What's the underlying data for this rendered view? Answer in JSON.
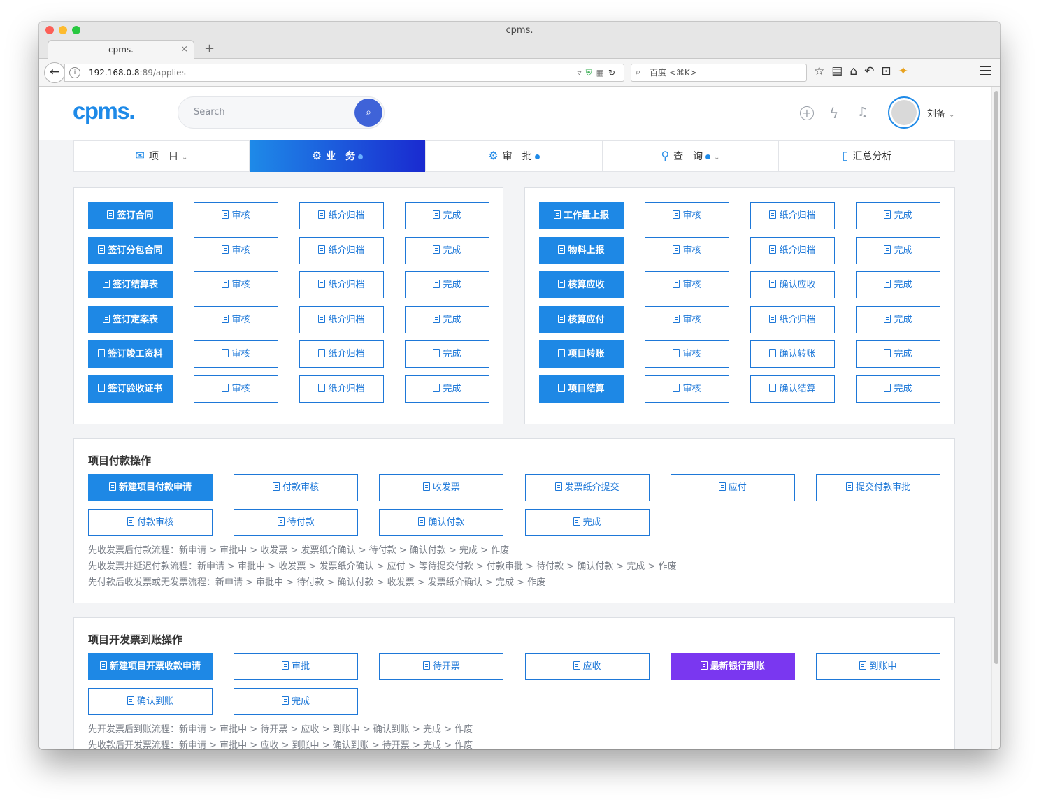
{
  "browser": {
    "window_title": "cpms.",
    "tab_title": "cpms.",
    "tab_close": "×",
    "new_tab": "+",
    "url_host": "192.168.0.8",
    "url_path": ":89/applies",
    "search_placeholder": "百度 <⌘K>"
  },
  "header": {
    "logo": "cpms.",
    "search_placeholder": "Search",
    "user_name": "刘备"
  },
  "nav": [
    {
      "label": "项　目",
      "icon": "envelope-icon",
      "dot": false,
      "chevron": true
    },
    {
      "label": "业　务",
      "icon": "gear-icon",
      "dot": true,
      "chevron": false
    },
    {
      "label": "审　批",
      "icon": "gear-icon",
      "dot": true,
      "chevron": false
    },
    {
      "label": "查　询",
      "icon": "search-icon",
      "dot": true,
      "chevron": true
    },
    {
      "label": "汇总分析",
      "icon": "book-icon",
      "dot": false,
      "chevron": false
    }
  ],
  "grid_left": [
    [
      "签订合同",
      "审核",
      "纸介归档",
      "完成"
    ],
    [
      "签订分包合同",
      "审核",
      "纸介归档",
      "完成"
    ],
    [
      "签订结算表",
      "审核",
      "纸介归档",
      "完成"
    ],
    [
      "签订定案表",
      "审核",
      "纸介归档",
      "完成"
    ],
    [
      "签订竣工资料",
      "审核",
      "纸介归档",
      "完成"
    ],
    [
      "签订验收证书",
      "审核",
      "纸介归档",
      "完成"
    ]
  ],
  "grid_right": [
    [
      "工作量上报",
      "审核",
      "纸介归档",
      "完成"
    ],
    [
      "物料上报",
      "审核",
      "纸介归档",
      "完成"
    ],
    [
      "核算应收",
      "审核",
      "确认应收",
      "完成"
    ],
    [
      "核算应付",
      "审核",
      "纸介归档",
      "完成"
    ],
    [
      "项目转账",
      "审核",
      "确认转账",
      "完成"
    ],
    [
      "项目结算",
      "审核",
      "确认结算",
      "完成"
    ]
  ],
  "payment": {
    "title": "项目付款操作",
    "buttons": [
      "新建项目付款申请",
      "付款审核",
      "收发票",
      "发票纸介提交",
      "应付",
      "提交付款审批",
      "付款审核",
      "待付款",
      "确认付款",
      "完成"
    ],
    "flows": [
      "先收发票后付款流程：新申请 > 审批中 > 收发票 > 发票纸介确认 > 待付款 > 确认付款 > 完成 > 作废",
      "先收发票并延迟付款流程：新申请 > 审批中 > 收发票 > 发票纸介确认 > 应付 > 等待提交付款 > 付款审批 > 待付款 > 确认付款 > 完成 > 作废",
      "先付款后收发票或无发票流程：新申请 > 审批中 > 待付款 > 确认付款 > 收发票 > 发票纸介确认 > 完成 > 作废"
    ]
  },
  "invoice": {
    "title": "项目开发票到账操作",
    "buttons": [
      "新建项目开票收款申请",
      "审批",
      "待开票",
      "应收",
      "最新银行到账",
      "到账中",
      "确认到账",
      "完成"
    ],
    "flows": [
      "先开发票后到账流程：新申请 > 审批中 > 待开票 > 应收 > 到账中 > 确认到账 > 完成 > 作废",
      "先收款后开发票流程：新申请 > 审批中 > 应收 > 到账中 > 确认到账 > 待开票 > 完成 > 作废"
    ]
  },
  "colors": {
    "primary": "#1e88e5",
    "purple": "#7a37f0",
    "nav_gradient_end": "#1a2ad0"
  }
}
